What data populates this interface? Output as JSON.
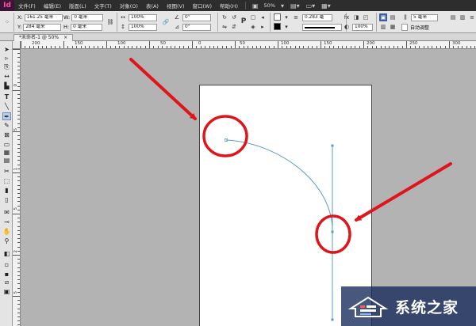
{
  "app": {
    "logo": "Id"
  },
  "menu": {
    "items": [
      "文件(F)",
      "编辑(E)",
      "版面(L)",
      "文字(T)",
      "对象(O)",
      "表(A)",
      "视图(V)",
      "窗口(W)",
      "帮助(H)"
    ],
    "zoom": "50%"
  },
  "control": {
    "x_label": "X:",
    "x_value": "161.25 毫米",
    "y_label": "Y:",
    "y_value": "284 毫米",
    "w_label": "W:",
    "w_value": "0 毫米",
    "h_label": "H:",
    "h_value": "0 毫米",
    "scale_x": "100%",
    "scale_y": "100%",
    "rotate": "0°",
    "shear": "0°",
    "stroke_weight": "0.283 毫",
    "opacity": "100%",
    "gap": "5 毫米",
    "auto_fit": "自动调整",
    "p_icon": "P"
  },
  "tab": {
    "label": "*未命名-1 @ 50%",
    "close": "×"
  },
  "ruler": {
    "h_labels": [
      "200",
      "150",
      "100",
      "50",
      "0",
      "50",
      "100",
      "150",
      "200",
      "250",
      "300"
    ],
    "v_labels": [
      "0",
      "5",
      "1",
      "5",
      "2",
      "5",
      "3"
    ]
  },
  "watermark": {
    "text": "系统之家"
  },
  "colors": {
    "annotation_red": "#e0151b",
    "path_blue": "#5a9fbe",
    "page_border": "#444444",
    "pasteboard": "#b3b3b3"
  }
}
